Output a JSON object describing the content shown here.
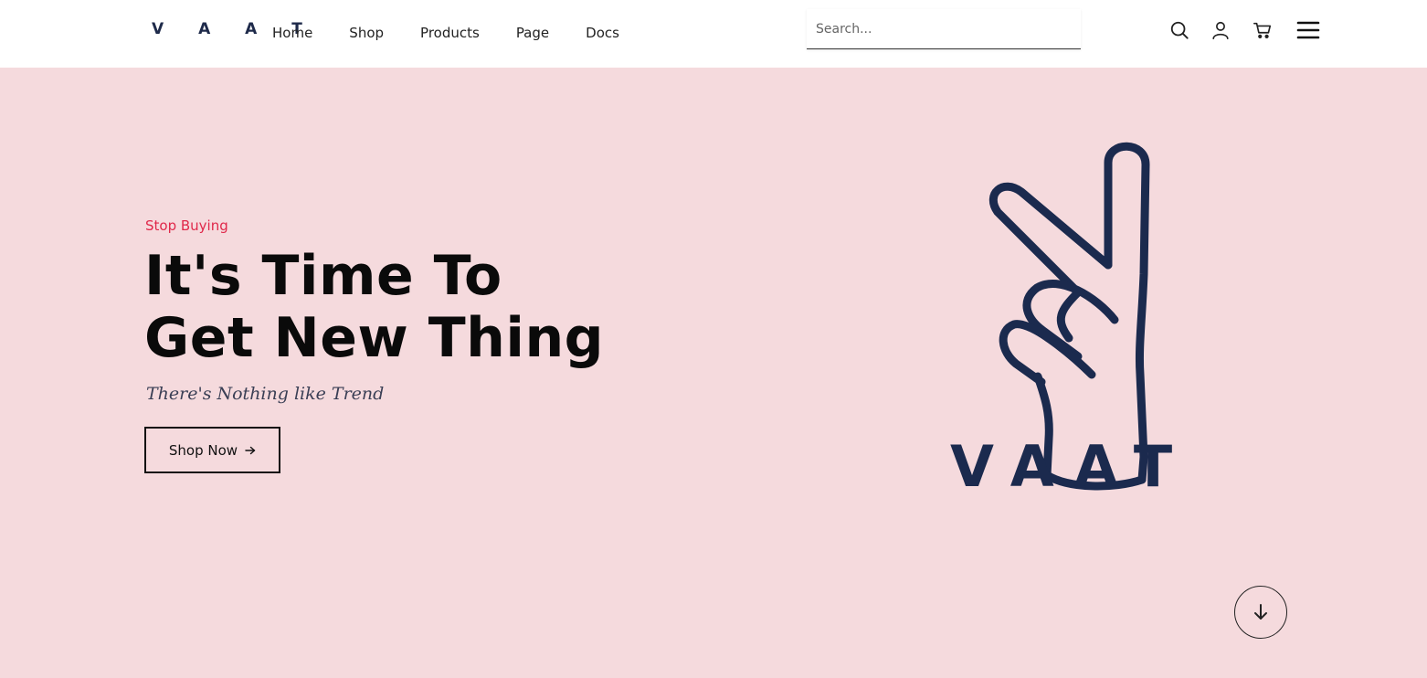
{
  "header": {
    "brand": "V A A T",
    "nav": [
      {
        "label": "Home"
      },
      {
        "label": "Shop"
      },
      {
        "label": "Products"
      },
      {
        "label": "Page"
      },
      {
        "label": "Docs"
      }
    ],
    "search": {
      "placeholder": "Search...",
      "value": ""
    },
    "icons": [
      "search-icon",
      "user-icon",
      "cart-icon",
      "menu-icon"
    ]
  },
  "hero": {
    "eyebrow": "Stop Buying",
    "headline_line1": "It's Time To",
    "headline_line2": "Get New Thing",
    "tagline": "There's Nothing like Trend",
    "cta_label": "Shop Now",
    "logo_text": "VAAT"
  },
  "colors": {
    "hero_bg": "#f5dadd",
    "accent": "#e0284a",
    "logo_navy": "#1e2a4a",
    "text_dark": "#0a0a0a"
  }
}
